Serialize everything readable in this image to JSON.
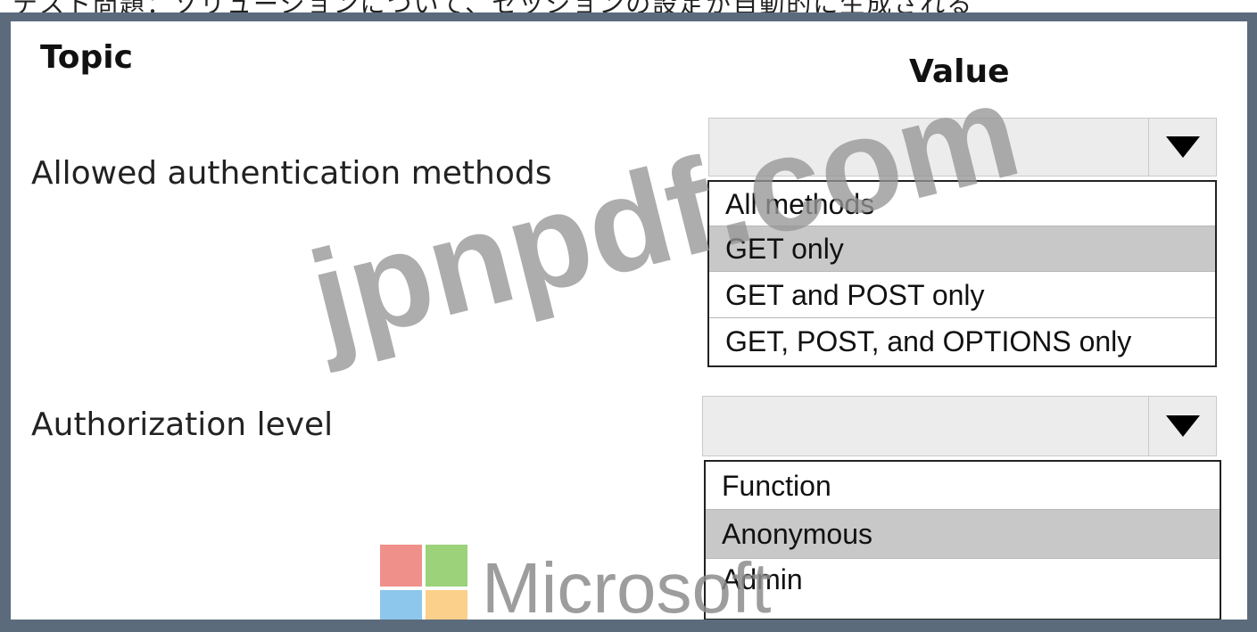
{
  "top_caption": "テスト問題：ソリューションについて、セッションの設定が自動的に生成される",
  "headers": {
    "topic": "Topic",
    "value": "Value"
  },
  "rows": [
    {
      "topic": "Allowed authentication methods",
      "selected_value": "",
      "options": [
        "All methods",
        "GET only",
        "GET and POST only",
        "GET, POST, and OPTIONS only"
      ],
      "highlighted": "GET only"
    },
    {
      "topic": "Authorization level",
      "selected_value": "",
      "options": [
        "Function",
        "Anonymous",
        "Admin"
      ],
      "highlighted": "Anonymous"
    }
  ],
  "watermark": "jpnpdf.com",
  "logo": {
    "text": "Microsoft",
    "colors": [
      "#f0908a",
      "#9cd27a",
      "#8ec7ec",
      "#fbd08a"
    ]
  },
  "icons": {
    "dropdown_arrow": "triangle-down-icon"
  },
  "colors": {
    "frame": "#5b6b7c",
    "highlight": "#c8c8c8",
    "select_bg": "#ececec"
  }
}
